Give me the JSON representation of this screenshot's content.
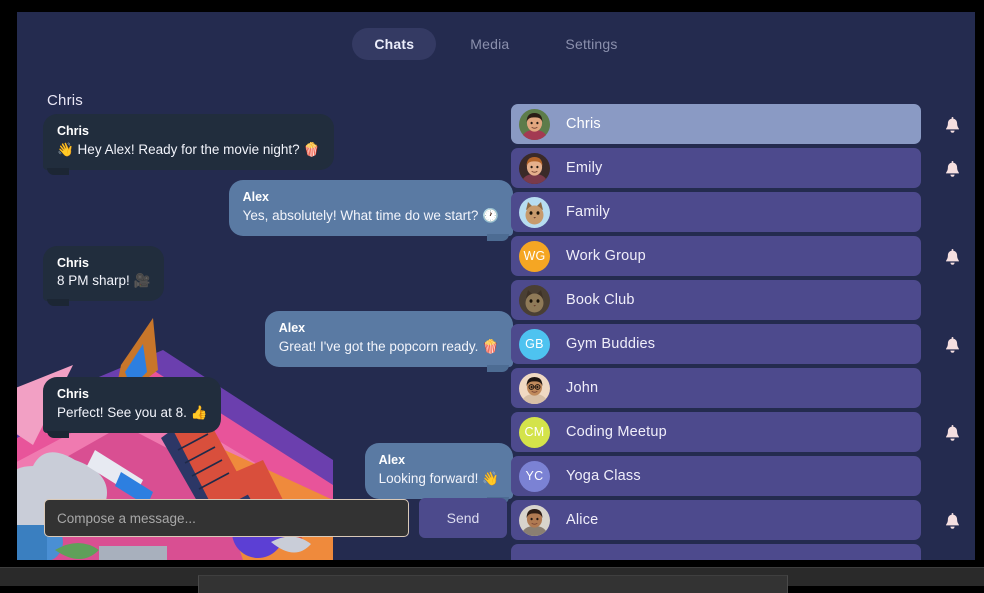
{
  "app": {
    "background_color": "#242b4f",
    "accent_color": "#4d4a8d",
    "selected_color": "#8a9ac4"
  },
  "tabs": [
    {
      "label": "Chats",
      "active": true,
      "name": "tab-chats"
    },
    {
      "label": "Media",
      "active": false,
      "name": "tab-media"
    },
    {
      "label": "Settings",
      "active": false,
      "name": "tab-settings"
    }
  ],
  "conversation": {
    "title": "Chris",
    "messages": [
      {
        "sender": "Chris",
        "text": "👋 Hey Alex! Ready for the movie night? 🍿",
        "side": "left",
        "own": false
      },
      {
        "sender": "Alex",
        "text": "Yes, absolutely! What time do we start? 🕐",
        "side": "right",
        "own": true
      },
      {
        "sender": "Chris",
        "text": "8 PM sharp! 🎥",
        "side": "left",
        "own": false
      },
      {
        "sender": "Alex",
        "text": "Great! I've got the popcorn ready. 🍿",
        "side": "right",
        "own": true
      },
      {
        "sender": "Chris",
        "text": "Perfect! See you at 8. 👍",
        "side": "left",
        "own": false
      },
      {
        "sender": "Alex",
        "text": "Looking forward! 👋",
        "side": "right",
        "own": true
      }
    ]
  },
  "composer": {
    "placeholder": "Compose a message...",
    "value": "",
    "send_label": "Send"
  },
  "chat_list": [
    {
      "name": "Chris",
      "avatar_type": "photo",
      "photo": "man1",
      "selected": true,
      "bell": true
    },
    {
      "name": "Emily",
      "avatar_type": "photo",
      "photo": "woman1",
      "selected": false,
      "bell": true
    },
    {
      "name": "Family",
      "avatar_type": "photo",
      "photo": "cat1",
      "selected": false,
      "bell": false
    },
    {
      "name": "Work Group",
      "avatar_type": "initials",
      "initials": "WG",
      "color": "#f5a623",
      "selected": false,
      "bell": true
    },
    {
      "name": "Book Club",
      "avatar_type": "photo",
      "photo": "cat2",
      "selected": false,
      "bell": false
    },
    {
      "name": "Gym Buddies",
      "avatar_type": "initials",
      "initials": "GB",
      "color": "#4ec3f0",
      "selected": false,
      "bell": true
    },
    {
      "name": "John",
      "avatar_type": "photo",
      "photo": "man2",
      "selected": false,
      "bell": false
    },
    {
      "name": "Coding Meetup",
      "avatar_type": "initials",
      "initials": "CM",
      "color": "#d4e34a",
      "selected": false,
      "bell": true
    },
    {
      "name": "Yoga Class",
      "avatar_type": "initials",
      "initials": "YC",
      "color": "#7b82d4",
      "selected": false,
      "bell": false
    },
    {
      "name": "Alice",
      "avatar_type": "photo",
      "photo": "woman2",
      "selected": false,
      "bell": true
    },
    {
      "name": "",
      "avatar_type": "none",
      "selected": false,
      "bell": false
    }
  ],
  "icons": {
    "bell": "bell-icon"
  }
}
